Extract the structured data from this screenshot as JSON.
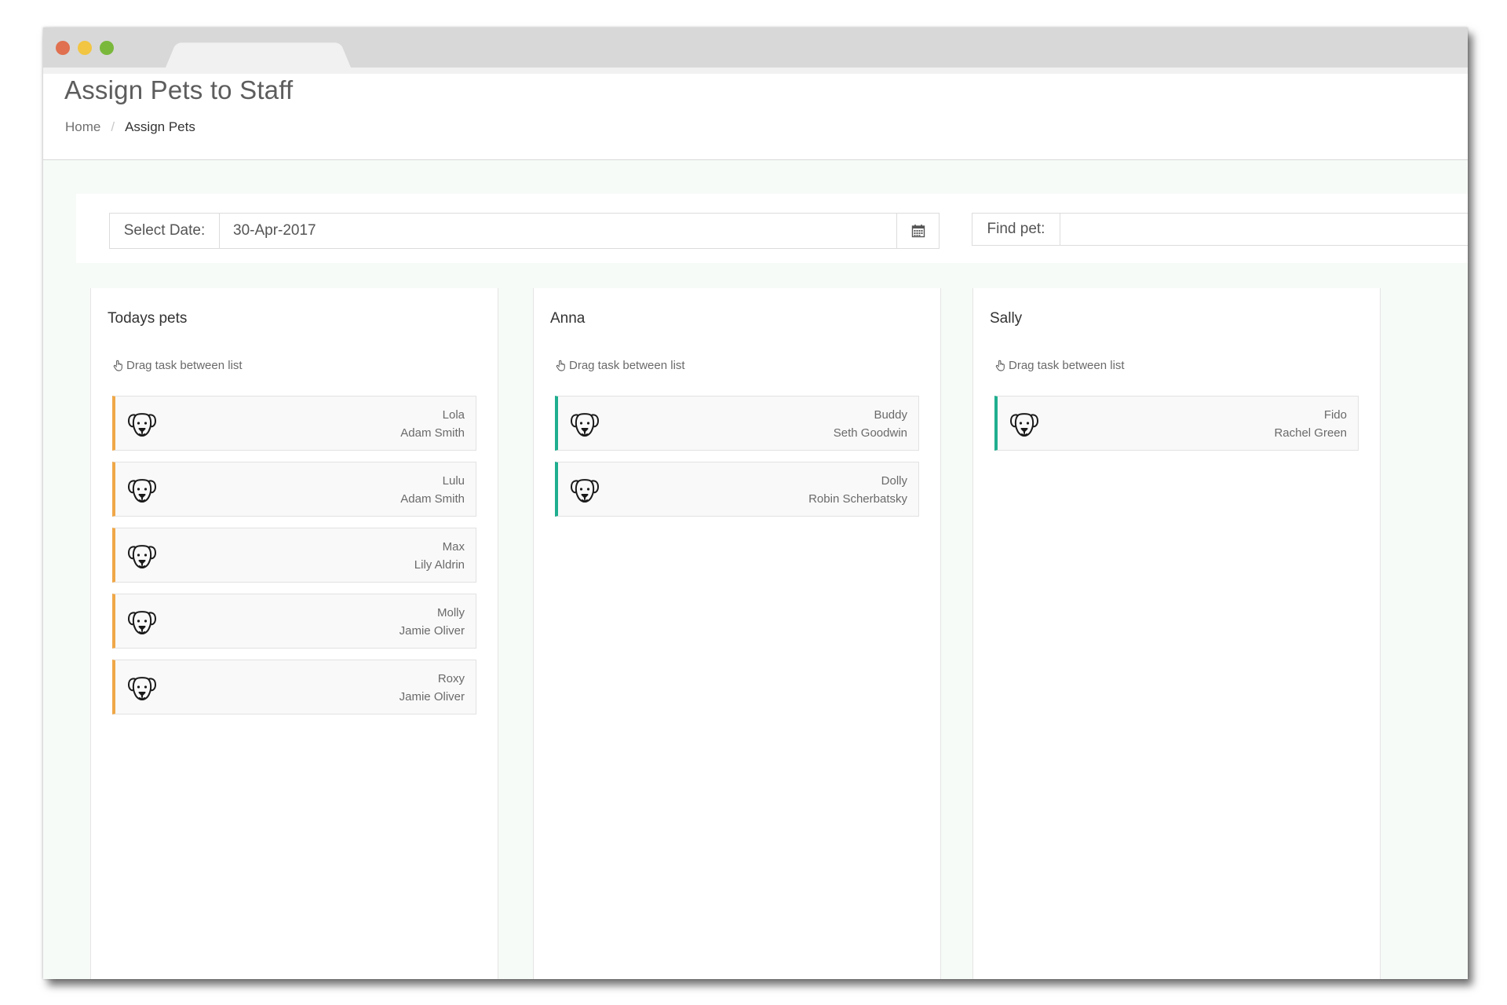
{
  "header": {
    "title": "Assign Pets to Staff",
    "breadcrumb": {
      "home": "Home",
      "separator": "/",
      "current": "Assign Pets"
    }
  },
  "filters": {
    "date_label": "Select Date:",
    "date_value": "30-Apr-2017",
    "calendar_icon": "calendar-icon",
    "find_label": "Find pet:",
    "find_value": ""
  },
  "hint_text": "Drag task between list",
  "columns": [
    {
      "title": "Todays pets",
      "pets": [
        {
          "name": "Lola",
          "owner": "Adam Smith"
        },
        {
          "name": "Lulu",
          "owner": "Adam Smith"
        },
        {
          "name": "Max",
          "owner": "Lily Aldrin"
        },
        {
          "name": "Molly",
          "owner": "Jamie Oliver"
        },
        {
          "name": "Roxy",
          "owner": "Jamie Oliver"
        }
      ]
    },
    {
      "title": "Anna",
      "pets": [
        {
          "name": "Buddy",
          "owner": "Seth Goodwin"
        },
        {
          "name": "Dolly",
          "owner": "Robin Scherbatsky"
        }
      ]
    },
    {
      "title": "Sally",
      "pets": [
        {
          "name": "Fido",
          "owner": "Rachel Green"
        }
      ]
    }
  ],
  "colors": {
    "unassigned_accent": "#f0a848",
    "assigned_accent": "#1fae8f",
    "window_close": "#e0704f",
    "window_minimize": "#f2c542",
    "window_maximize": "#7ab83c"
  }
}
